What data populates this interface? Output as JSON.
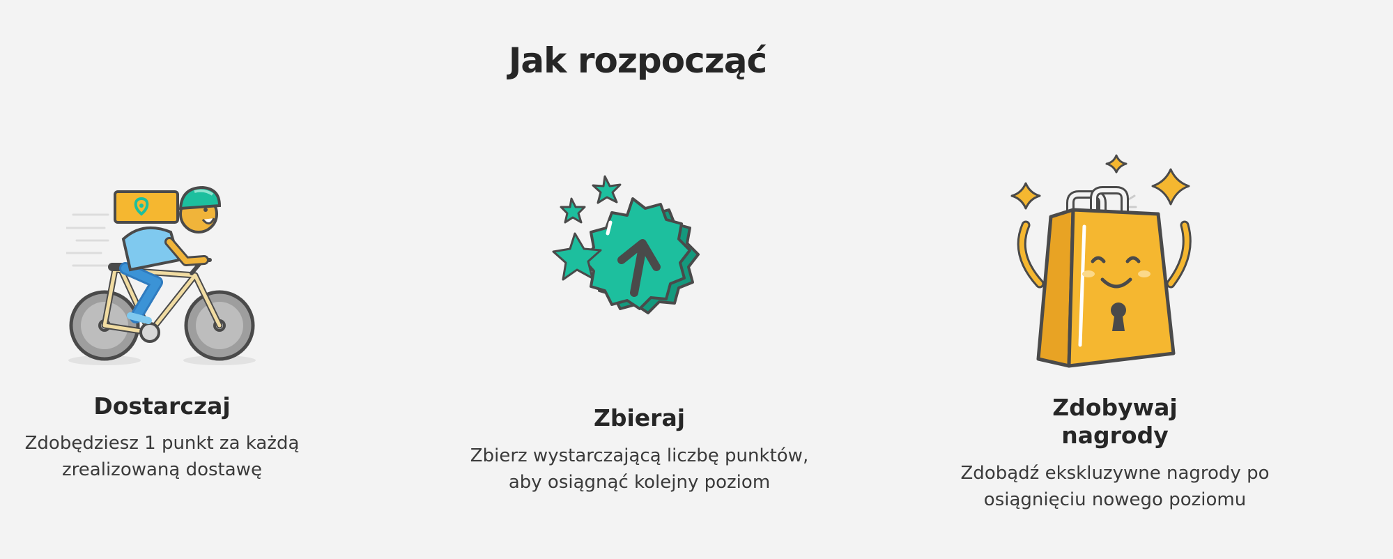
{
  "header": {
    "title": "Jak rozpocząć"
  },
  "steps": [
    {
      "icon": "courier-bike-icon",
      "title": "Dostarczaj",
      "description_line1": "Zdobędziesz 1 punkt za każdą",
      "description_line2": "zrealizowaną dostawę"
    },
    {
      "icon": "level-up-badge-icon",
      "title": "Zbieraj",
      "description_line1": "Zbierz wystarczającą liczbę punktów,",
      "description_line2": "aby osiągnąć kolejny poziom"
    },
    {
      "icon": "reward-bag-icon",
      "title_line1": "Zdobywaj",
      "title_line2": "nagrody",
      "description_line1": "Zdobądź ekskluzywne nagrody po",
      "description_line2": "osiągnięciu nowego poziomu"
    }
  ],
  "colors": {
    "background": "#f3f3f3",
    "teal": "#1dbf9e",
    "yellow": "#f5b730",
    "outline": "#4a4a4a"
  }
}
